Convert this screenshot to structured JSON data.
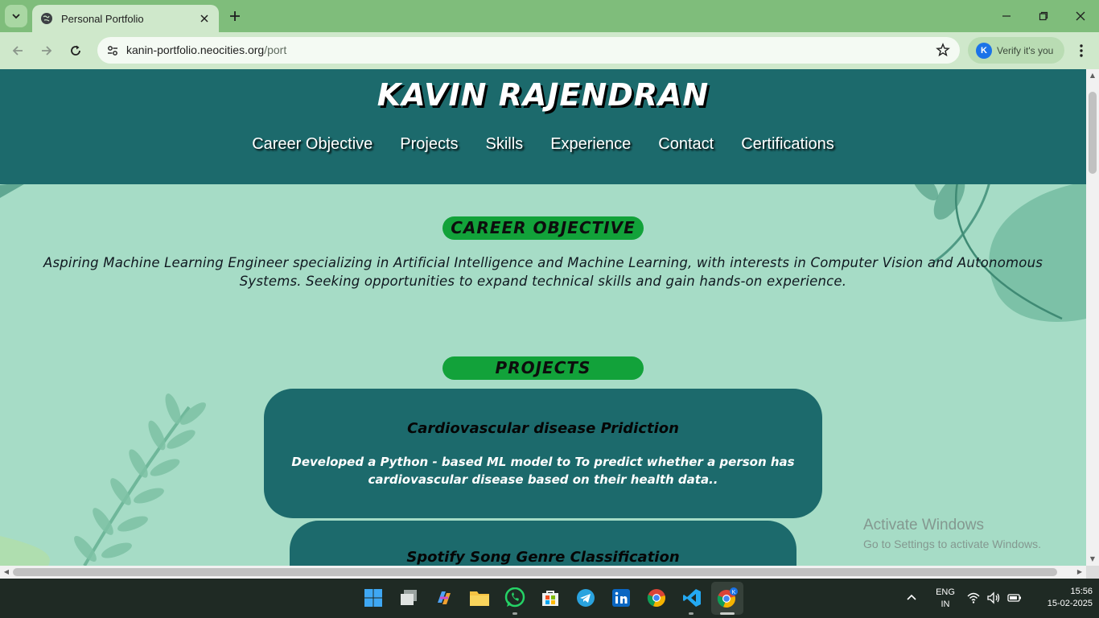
{
  "browser": {
    "tab_title": "Personal Portfolio",
    "url_host": "kanin-portfolio.neocities.org",
    "url_path": "/port",
    "profile_label": "Verify it's you",
    "profile_initial": "K"
  },
  "site": {
    "title": "KAVIN RAJENDRAN",
    "nav": [
      "Career Objective",
      "Projects",
      "Skills",
      "Experience",
      "Contact",
      "Certifications"
    ],
    "career_heading": "CAREER OBJECTIVE",
    "career_text": "Aspiring Machine Learning Engineer specializing in Artificial Intelligence and Machine Learning, with interests in Computer Vision and Autonomous Systems. Seeking opportunities to expand technical skills and gain hands-on experience.",
    "projects_heading": "PROJECTS",
    "projects": [
      {
        "title": "Cardiovascular disease Pridiction",
        "description": "Developed a Python - based ML model to To predict whether a person has cardiovascular disease based on their health data.."
      },
      {
        "title": "Spotify Song Genre Classification",
        "description": ""
      }
    ]
  },
  "watermark": {
    "line1": "Activate Windows",
    "line2": "Go to Settings to activate Windows."
  },
  "system_tray": {
    "lang_top": "ENG",
    "lang_bottom": "IN",
    "time": "15:56",
    "date": "15-02-2025"
  },
  "colors": {
    "header_bg": "#1c6a6c",
    "page_bg": "#a6dcc6",
    "pill_green": "#12a23a",
    "chrome_green": "#7fbd7b"
  }
}
